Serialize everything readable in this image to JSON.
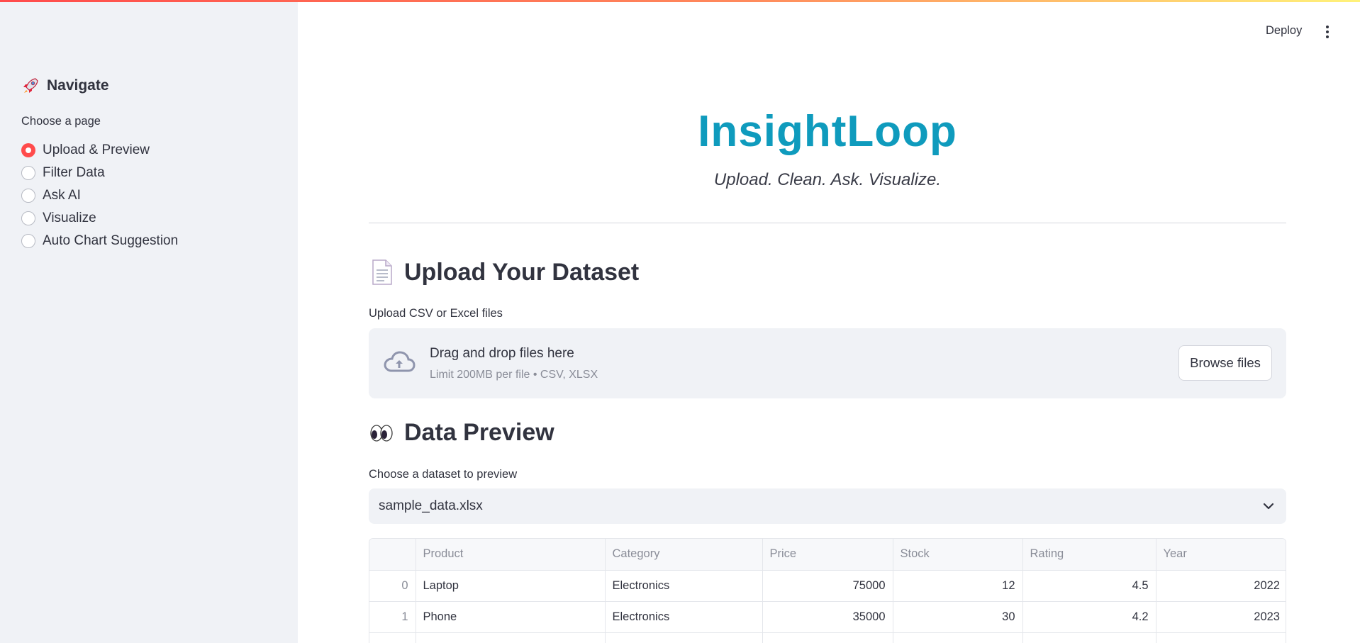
{
  "sidebar": {
    "header": "Navigate",
    "radio_label": "Choose a page",
    "pages": [
      {
        "label": "Upload & Preview",
        "selected": true
      },
      {
        "label": "Filter Data",
        "selected": false
      },
      {
        "label": "Ask AI",
        "selected": false
      },
      {
        "label": "Visualize",
        "selected": false
      },
      {
        "label": "Auto Chart Suggestion",
        "selected": false
      }
    ]
  },
  "header": {
    "deploy_label": "Deploy"
  },
  "app": {
    "title": "InsightLoop",
    "subtitle": "Upload. Clean. Ask. Visualize."
  },
  "upload": {
    "heading": "Upload Your Dataset",
    "field_label": "Upload CSV or Excel files",
    "dropzone_title": "Drag and drop files here",
    "dropzone_limit": "Limit 200MB per file • CSV, XLSX",
    "browse_label": "Browse files"
  },
  "preview": {
    "heading": "Data Preview",
    "select_label": "Choose a dataset to preview",
    "selected_dataset": "sample_data.xlsx",
    "table": {
      "columns": [
        "",
        "Product",
        "Category",
        "Price",
        "Stock",
        "Rating",
        "Year"
      ],
      "rows": [
        {
          "index": "0",
          "product": "Laptop",
          "category": "Electronics",
          "price": "75000",
          "stock": "12",
          "rating": "4.5",
          "year": "2022"
        },
        {
          "index": "1",
          "product": "Phone",
          "category": "Electronics",
          "price": "35000",
          "stock": "30",
          "rating": "4.2",
          "year": "2023"
        }
      ]
    }
  },
  "colors": {
    "accent_red": "#ff4b4b",
    "title_teal": "#0f9bbd",
    "sidebar_bg": "#f0f2f6"
  }
}
